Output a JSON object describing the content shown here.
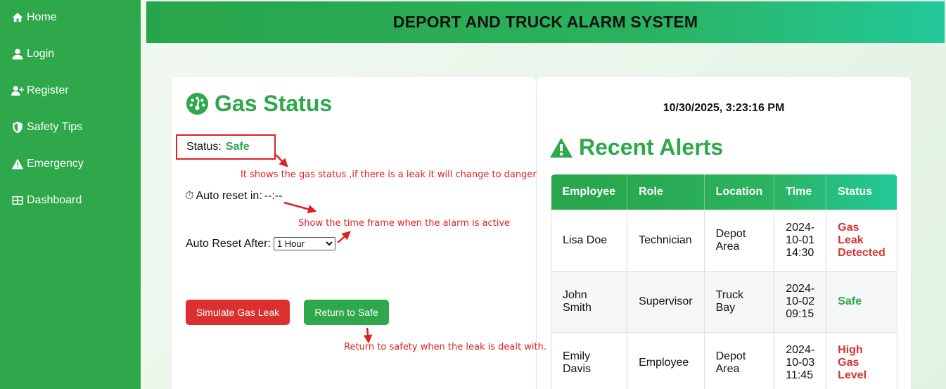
{
  "sidebar": {
    "items": [
      {
        "label": "Home",
        "icon": "home-icon"
      },
      {
        "label": "Login",
        "icon": "user-icon"
      },
      {
        "label": "Register",
        "icon": "user-plus-icon"
      },
      {
        "label": "Safety Tips",
        "icon": "shield-icon"
      },
      {
        "label": "Emergency",
        "icon": "warning-icon"
      },
      {
        "label": "Dashboard",
        "icon": "table-icon"
      }
    ]
  },
  "header": {
    "title": "DEPORT AND TRUCK ALARM SYSTEM"
  },
  "gas": {
    "title": "Gas Status",
    "status_label": "Status:",
    "status_value": "Safe",
    "timer_glyph": "⏱",
    "auto_reset_in_label": "Auto reset in:",
    "auto_reset_in_value": "--:--",
    "auto_reset_after_label": "Auto Reset After:",
    "auto_reset_after_value": "1 Hour",
    "simulate_button": "Simulate Gas Leak",
    "safe_button": "Return to Safe"
  },
  "annotations": {
    "status_note": "It shows the gas status ,if there is a leak it will change to danger",
    "timer_note": "Show the time frame when the alarm is active",
    "safe_note": "Return to safety when the leak is dealt with."
  },
  "alerts": {
    "datetime": "10/30/2025, 3:23:16 PM",
    "title": "Recent Alerts",
    "columns": [
      "Employee",
      "Role",
      "Location",
      "Time",
      "Status"
    ],
    "rows": [
      {
        "employee": "Lisa Doe",
        "role": "Technician",
        "location": "Depot Area",
        "time": "2024-10-01 14:30",
        "status": "Gas Leak Detected",
        "level": "danger"
      },
      {
        "employee": "John Smith",
        "role": "Supervisor",
        "location": "Truck Bay",
        "time": "2024-10-02 09:15",
        "status": "Safe",
        "level": "safe"
      },
      {
        "employee": "Emily Davis",
        "role": "Employee",
        "location": "Depot Area",
        "time": "2024-10-03 11:45",
        "status": "High Gas Level",
        "level": "danger"
      }
    ]
  },
  "colors": {
    "accent_green": "#2ea84a",
    "danger_red": "#dc3030",
    "annotation_red": "#e02020"
  }
}
